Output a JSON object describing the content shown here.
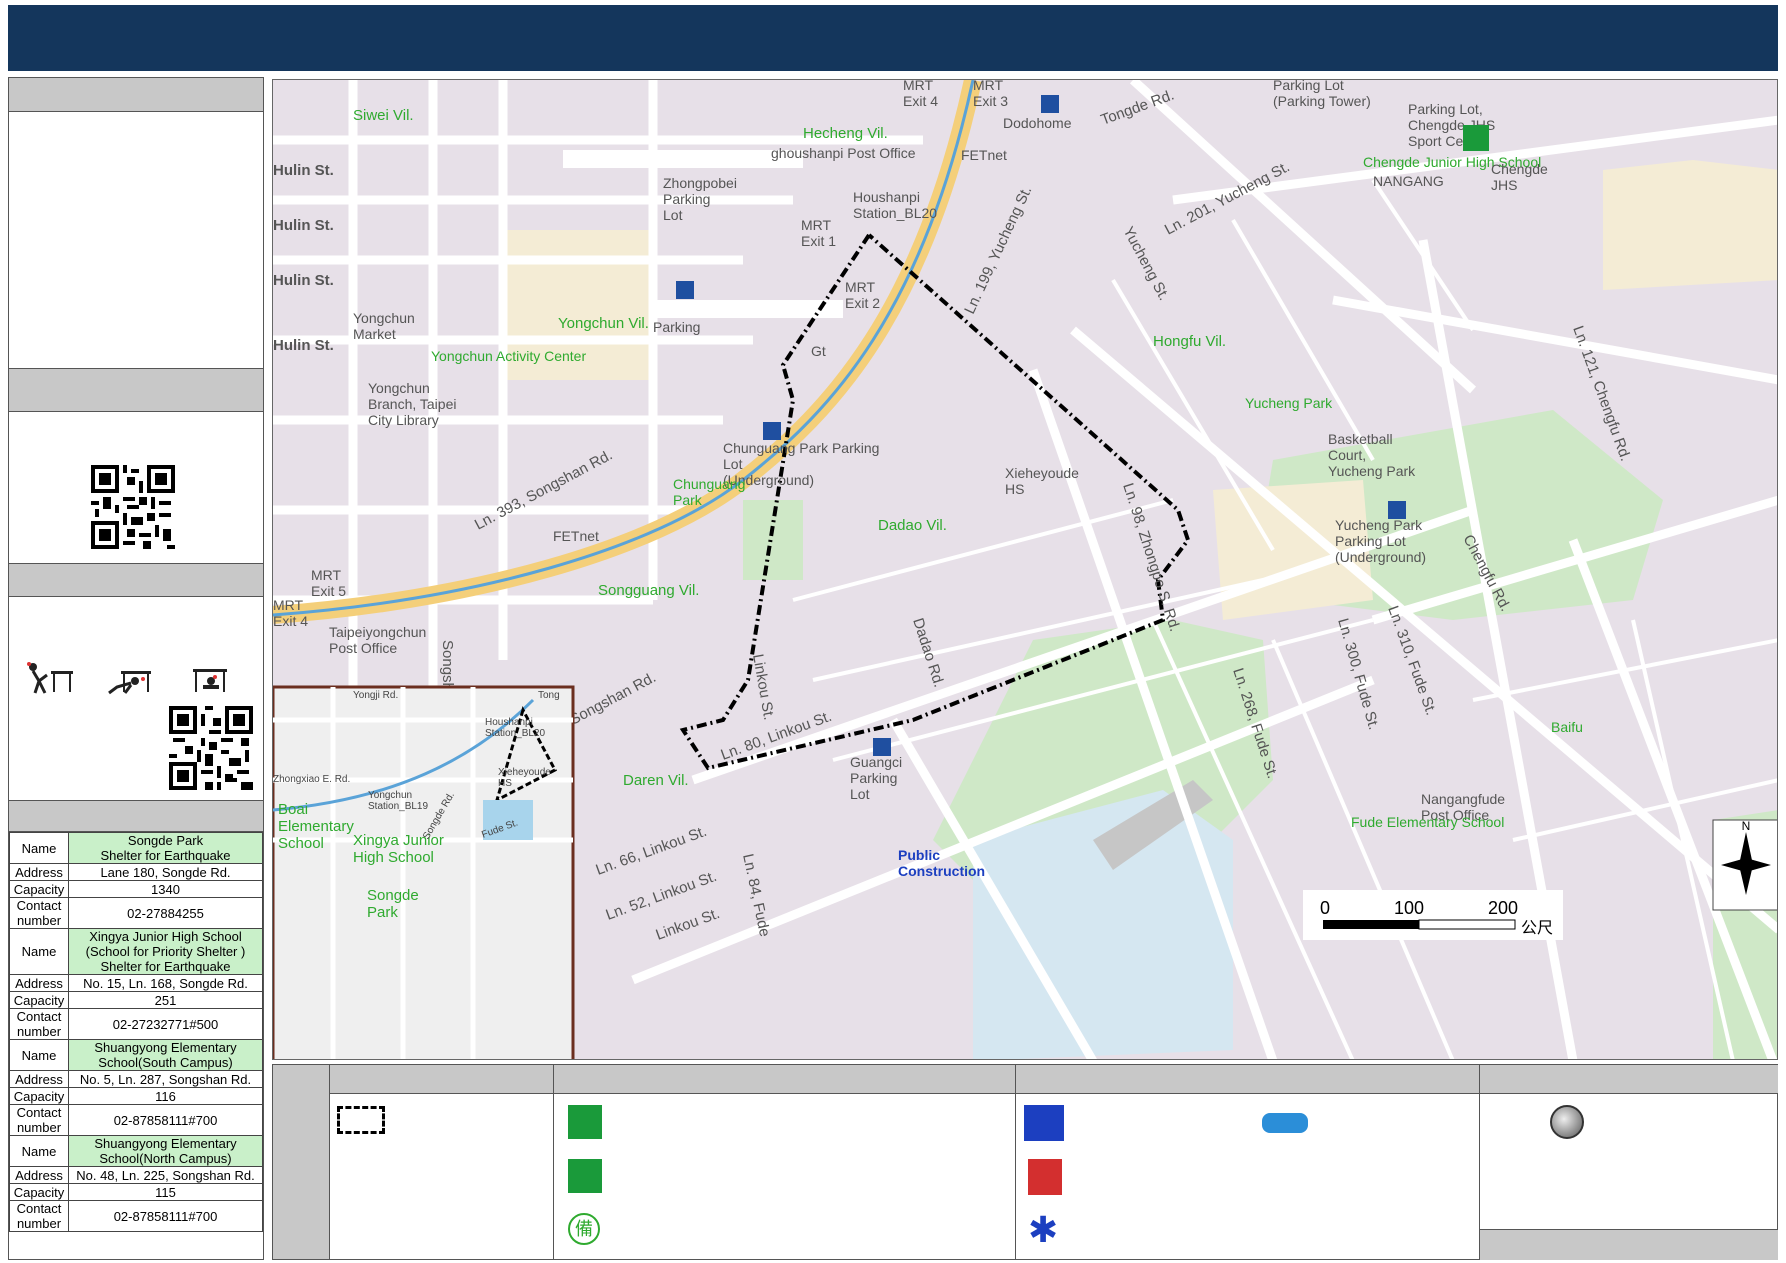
{
  "map": {
    "village_labels": [
      "Siwei Vil.",
      "Hecheng Vil.",
      "Yongchun Vil.",
      "Hongfu Vil.",
      "Dadao Vil.",
      "Songguang Vil.",
      "Daren Vil."
    ],
    "street_labels": [
      "Hulin St.",
      "Hulin St.",
      "Hulin St.",
      "Hulin St.",
      "Tongde Rd.",
      "Ln. 201, Yucheng St.",
      "Ln. 199, Yucheng St.",
      "Yucheng St.",
      "Ln. 393, Songshan Rd.",
      "Ln. 98, Zhongpo S. Rd.",
      "Dadao Rd.",
      "Ln. 268, Fude St.",
      "Ln. 300, Fude St.",
      "Ln. 310, Fude St.",
      "Chengfu Rd.",
      "Ln. 121, Chengfu Rd.",
      "Ln. 66, Linkou St.",
      "Ln. 52, Linkou St.",
      "Linkou St.",
      "Ln. 84, Fude",
      "Linkou St.",
      "Songshan Rd.",
      "Songshan Rd.",
      "Ln. 80, Linkou St."
    ],
    "poi_labels": {
      "mrt_exit_4_top": "MRT\nExit 4",
      "mrt_exit_3_top": "MRT\nExit 3",
      "dodohome": "Dodohome",
      "parking_lot_tower": "Parking Lot\n(Parking Tower)",
      "post_office_top": "ghoushanpi Post Office",
      "fetnet_top": "FETnet",
      "zhongpobei_parking": "Zhongpobei\nParking\nLot",
      "mrt_exit_1": "MRT\nExit 1",
      "houshanpi_station": "Houshanpi\nStation_BL20",
      "mrt_exit_2": "MRT\nExit 2",
      "parking": "Parking",
      "gt": "Gt",
      "yongchun_market": "Yongchun\nMarket",
      "yongchun_activity": "Yongchun Activity Center",
      "yongchun_library": "Yongchun\nBranch, Taipei\nCity Library",
      "chunguang_parking": "Chunguang Park Parking\nLot\n(Underground)",
      "chunguang_park": "Chunguang\nPark",
      "xieheyoude": "Xieheyoude\nHS",
      "yucheng_park": "Yucheng Park",
      "basketball": "Basketball\nCourt,\nYucheng Park",
      "yucheng_parking": "Yucheng Park\nParking Lot\n(Underground)",
      "fetnet_mid": "FETnet",
      "mrt_exit_5": "MRT\nExit 5",
      "mrt_exit_4_left": "MRT\nExit 4",
      "post_office_left": "Taipeiyongchun\nPost Office",
      "guangci_parking": "Guangci\nParking\nLot",
      "public_construction": "Public\nConstruction",
      "nangangfude": "Nangangfude\nPost Office",
      "fude_school": "Fude Elementary School",
      "baifu": "Baifu",
      "chengde_parking": "Parking Lot,\nChengde JHS\nSport Center",
      "chengde_school": "Chengde Junior High School",
      "nangang": "NANGANG",
      "chengde_jhs": "Chengde\nJHS",
      "fude_ab": "Fude ES"
    },
    "inset": {
      "labels": [
        "Yongji Rd.",
        "Zhongxiao E. Rd.",
        "Houshanpi\nStation_BL20",
        "Yongchun\nStation_BL19",
        "Xieheyoude\nHS",
        "Fude St.",
        "Boai\nElementary\nSchool",
        "Xingya Junior\nHigh School",
        "Songde\nPark",
        "Songde Rd.",
        "Tong"
      ]
    },
    "scale": {
      "ticks": [
        "0",
        "100",
        "200"
      ],
      "unit": "公尺"
    },
    "north": "N"
  },
  "shelters": [
    {
      "name": "Songde Park\nShelter for Earthquake",
      "address": "Lane 180, Songde Rd.",
      "capacity": "1340",
      "contact": "02-27884255"
    },
    {
      "name": "Xingya Junior High School\n(School for Priority Shelter )\nShelter for Earthquake",
      "address": "No. 15, Ln. 168, Songde Rd.",
      "capacity": "251",
      "contact": "02-27232771#500"
    },
    {
      "name": "Shuangyong Elementary\nSchool(South Campus)",
      "address": "No. 5, Ln. 287, Songshan Rd.",
      "capacity": "116",
      "contact": "02-87858111#700"
    },
    {
      "name": "Shuangyong Elementary\nSchool(North Campus)",
      "address": "No. 48, Ln. 225, Songshan Rd.",
      "capacity": "115",
      "contact": "02-87858111#700"
    }
  ],
  "shelter_labels": {
    "name": "Name",
    "address": "Address",
    "capacity": "Capacity",
    "contact": "Contact\nnumber"
  },
  "colors": {
    "banner": "#14365c",
    "village": "#2faa2f",
    "block": "#e2dbe3",
    "road": "#ffffff",
    "park": "#cfe8c7",
    "mrt": "#f4cf7a",
    "boundary": "#000000"
  }
}
